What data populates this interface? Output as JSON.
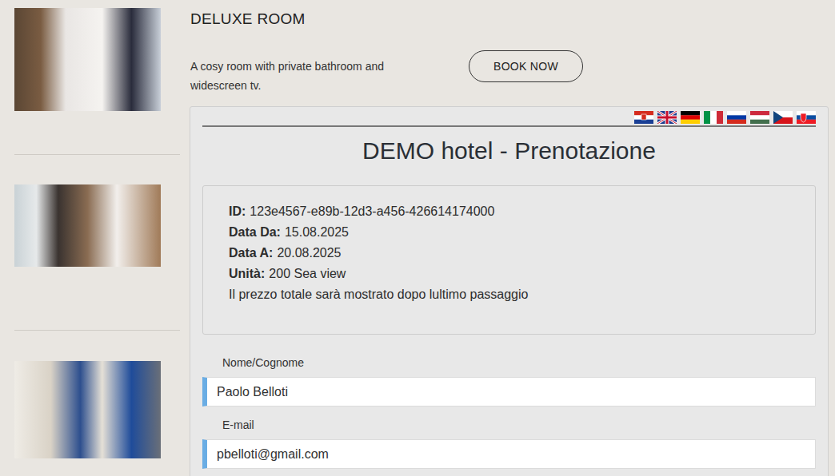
{
  "header": {
    "title": "DELUXE ROOM",
    "description": "A cosy room with private bathroom and widescreen tv.",
    "button": "BOOK NOW"
  },
  "panel": {
    "title": "DEMO hotel - Prenotazione"
  },
  "booking": {
    "lines": [
      {
        "label": "ID:",
        "value": "123e4567-e89b-12d3-a456-426614174000"
      },
      {
        "label": "Data Da:",
        "value": "15.08.2025"
      },
      {
        "label": "Data A:",
        "value": "20.08.2025"
      },
      {
        "label": "Unità:",
        "value": "200 Sea view"
      }
    ],
    "note": "Il prezzo totale sarà mostrato dopo lultimo passaggio"
  },
  "form": {
    "fields": [
      {
        "label": "Nome/Cognome",
        "value": "Paolo Belloti"
      },
      {
        "label": "E-mail",
        "value": "pbelloti@gmail.com"
      }
    ]
  }
}
